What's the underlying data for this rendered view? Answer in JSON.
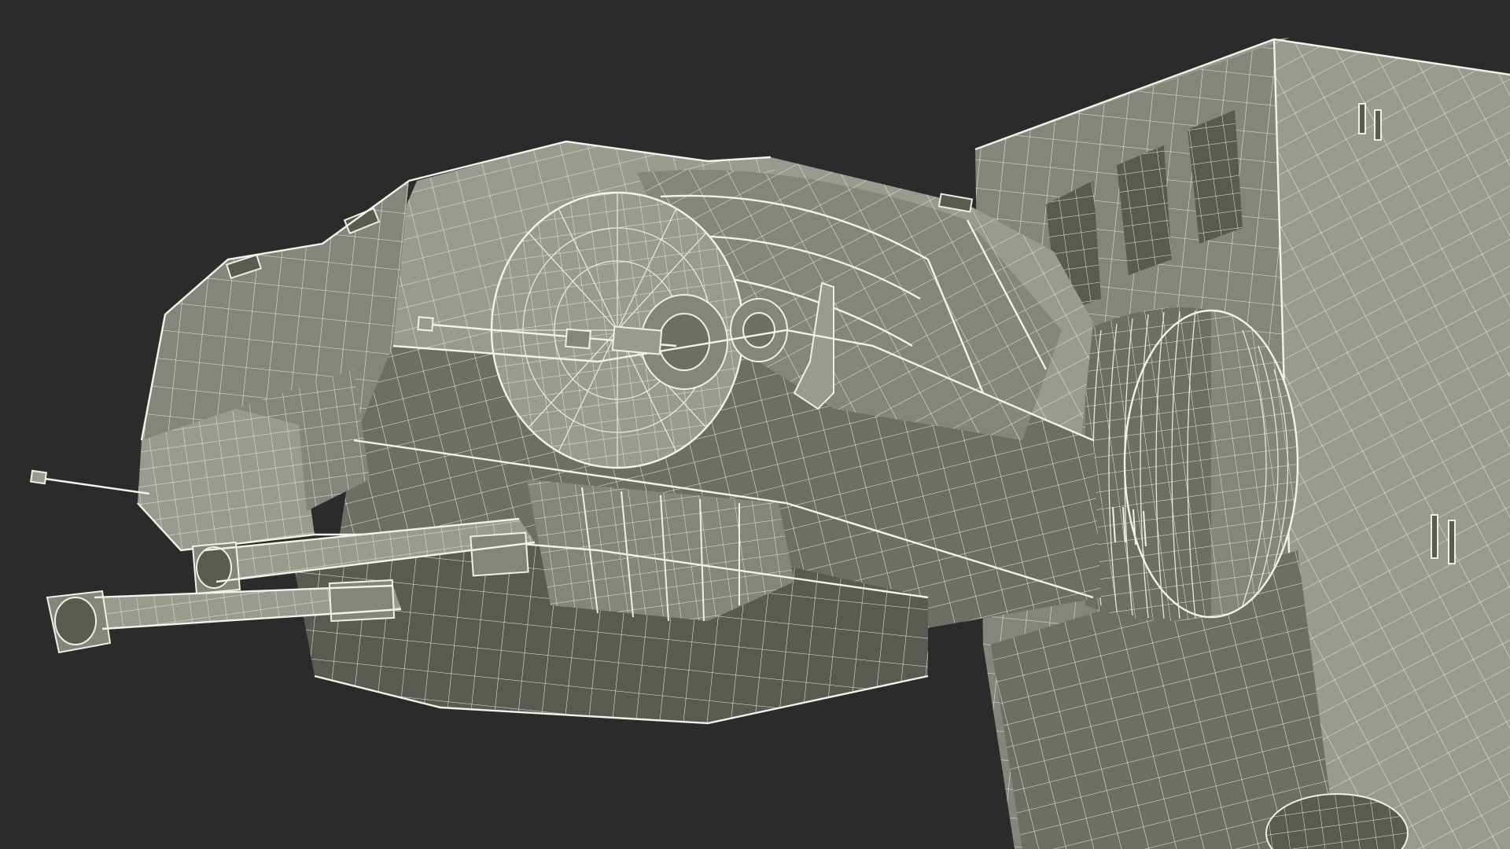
{
  "scene": {
    "subject": "",
    "background_color": "#2b2b2b",
    "model_color": "#8d8d83",
    "wire_color": "#e8e8d8"
  }
}
